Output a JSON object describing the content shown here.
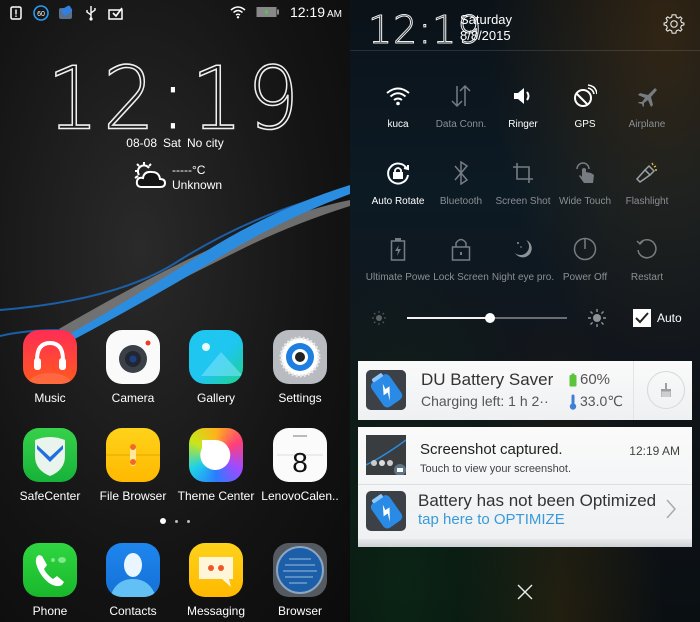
{
  "home": {
    "statusbar": {
      "left_icons": [
        "sd-card-alert-icon",
        "sixty-badge-icon",
        "du-battery-icon",
        "usb-icon",
        "clipboard-check-icon"
      ],
      "sixty_badge": "60",
      "time": "12:19",
      "ampm": "AM",
      "battery_charging": true
    },
    "clock": {
      "hours": "12",
      "minutes": "19"
    },
    "date": {
      "day": "08-08",
      "weekday": "Sat",
      "city": "No city"
    },
    "weather": {
      "temp": "-----°C",
      "condition": "Unknown",
      "icon": "partly-cloudy-icon"
    },
    "apps": [
      {
        "label": "Music",
        "icon": "music-headphones-icon"
      },
      {
        "label": "Camera",
        "icon": "camera-icon"
      },
      {
        "label": "Gallery",
        "icon": "gallery-icon"
      },
      {
        "label": "Settings",
        "icon": "settings-gear-icon"
      },
      {
        "label": "SafeCenter",
        "icon": "shield-icon"
      },
      {
        "label": "File Browser",
        "icon": "folder-icon"
      },
      {
        "label": "Theme Center",
        "icon": "theme-icon"
      },
      {
        "label": "LenovoCalen..",
        "icon": "calendar-icon",
        "calendar_day": "8"
      }
    ],
    "page_indicator": {
      "pages": 3,
      "active": 0
    },
    "dock": [
      {
        "label": "Phone",
        "icon": "phone-icon"
      },
      {
        "label": "Contacts",
        "icon": "contact-icon"
      },
      {
        "label": "Messaging",
        "icon": "message-icon"
      },
      {
        "label": "Browser",
        "icon": "globe-icon"
      }
    ]
  },
  "shade": {
    "time": "12:19",
    "weekday": "Saturday",
    "date": "8/8/2015",
    "tiles": [
      {
        "label": "kuca",
        "icon": "wifi-icon",
        "on": true
      },
      {
        "label": "Data Conn.",
        "icon": "data-arrows-icon",
        "on": false
      },
      {
        "label": "Ringer",
        "icon": "speaker-icon",
        "on": true
      },
      {
        "label": "GPS",
        "icon": "gps-satellite-icon",
        "on": true
      },
      {
        "label": "Airplane",
        "icon": "airplane-icon",
        "on": false
      },
      {
        "label": "Auto Rotate",
        "icon": "rotate-lock-icon",
        "on": true
      },
      {
        "label": "Bluetooth",
        "icon": "bluetooth-icon",
        "on": false
      },
      {
        "label": "Screen Shot",
        "icon": "crop-icon",
        "on": false
      },
      {
        "label": "Wide Touch",
        "icon": "touch-hand-icon",
        "on": false
      },
      {
        "label": "Flashlight",
        "icon": "flashlight-icon",
        "on": false
      },
      {
        "label": "Ultimate Powe",
        "icon": "battery-bolt-icon",
        "on": false
      },
      {
        "label": "Lock Screen",
        "icon": "padlock-icon",
        "on": false
      },
      {
        "label": "Night eye pro.",
        "icon": "moon-icon",
        "on": false
      },
      {
        "label": "Power Off",
        "icon": "power-icon",
        "on": false
      },
      {
        "label": "Restart",
        "icon": "restart-icon",
        "on": false
      }
    ],
    "brightness": {
      "level": 0.52,
      "auto_label": "Auto",
      "auto_checked": true
    },
    "notifications": [
      {
        "app": "DU Battery Saver",
        "battery": "60%",
        "subtitle": "Charging left: 1 h 2··",
        "temperature": "33.0℃"
      },
      {
        "title": "Screenshot captured.",
        "time": "12:19 AM",
        "body": "Touch to view your screenshot."
      },
      {
        "title": "Battery has not been Optimized",
        "link": "tap here to OPTIMIZE"
      }
    ],
    "colors": {
      "link_blue": "#3a9ad9",
      "battery_green": "#5cc43a",
      "thermo_blue": "#3f7fd6"
    }
  }
}
